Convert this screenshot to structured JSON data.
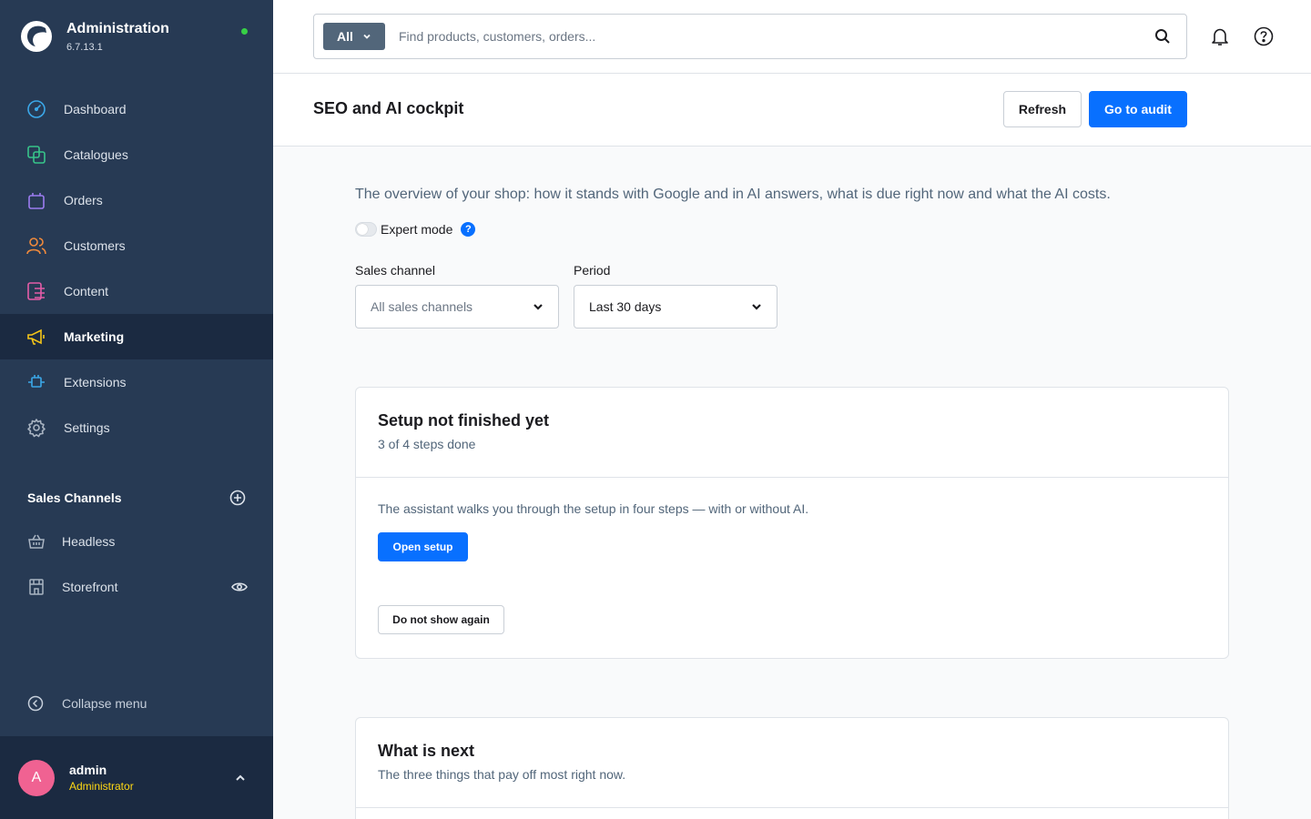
{
  "app": {
    "title": "Administration",
    "version": "6.7.13.1"
  },
  "nav": {
    "items": [
      {
        "label": "Dashboard",
        "icon": "dashboard-icon",
        "active": false
      },
      {
        "label": "Catalogues",
        "icon": "catalogues-icon",
        "active": false
      },
      {
        "label": "Orders",
        "icon": "orders-icon",
        "active": false
      },
      {
        "label": "Customers",
        "icon": "customers-icon",
        "active": false
      },
      {
        "label": "Content",
        "icon": "content-icon",
        "active": false
      },
      {
        "label": "Marketing",
        "icon": "megaphone-icon",
        "active": true
      },
      {
        "label": "Extensions",
        "icon": "plug-icon",
        "active": false
      },
      {
        "label": "Settings",
        "icon": "gear-icon",
        "active": false
      }
    ]
  },
  "sales_channels": {
    "title": "Sales Channels",
    "items": [
      {
        "label": "Headless",
        "icon": "basket-icon"
      },
      {
        "label": "Storefront",
        "icon": "storefront-icon"
      }
    ]
  },
  "sidebar_footer": {
    "collapse_label": "Collapse menu"
  },
  "user": {
    "initial": "A",
    "name": "admin",
    "role": "Administrator"
  },
  "search": {
    "type_label": "All",
    "placeholder": "Find products, customers, orders..."
  },
  "page": {
    "title": "SEO and AI cockpit",
    "refresh_label": "Refresh",
    "audit_label": "Go to audit",
    "intro": "The overview of your shop: how it stands with Google and in AI answers, what is due right now and what the AI costs.",
    "expert_mode_label": "Expert mode",
    "expert_mode_on": false,
    "help_glyph": "?"
  },
  "filters": {
    "sales_channel": {
      "label": "Sales channel",
      "value": "All sales channels"
    },
    "period": {
      "label": "Period",
      "value": "Last 30 days"
    }
  },
  "setup_card": {
    "title": "Setup not finished yet",
    "subtitle": "3 of 4 steps done",
    "text": "The assistant walks you through the setup in four steps — with or without AI.",
    "open_label": "Open setup",
    "dismiss_label": "Do not show again"
  },
  "next_card": {
    "title": "What is next",
    "subtitle": "The three things that pay off most right now."
  },
  "colors": {
    "sidebar": "#273a54",
    "sidebar_active": "#1b2a41",
    "primary": "#0870ff",
    "online": "#37d046",
    "role": "#ffd814",
    "avatar": "#f06292"
  }
}
